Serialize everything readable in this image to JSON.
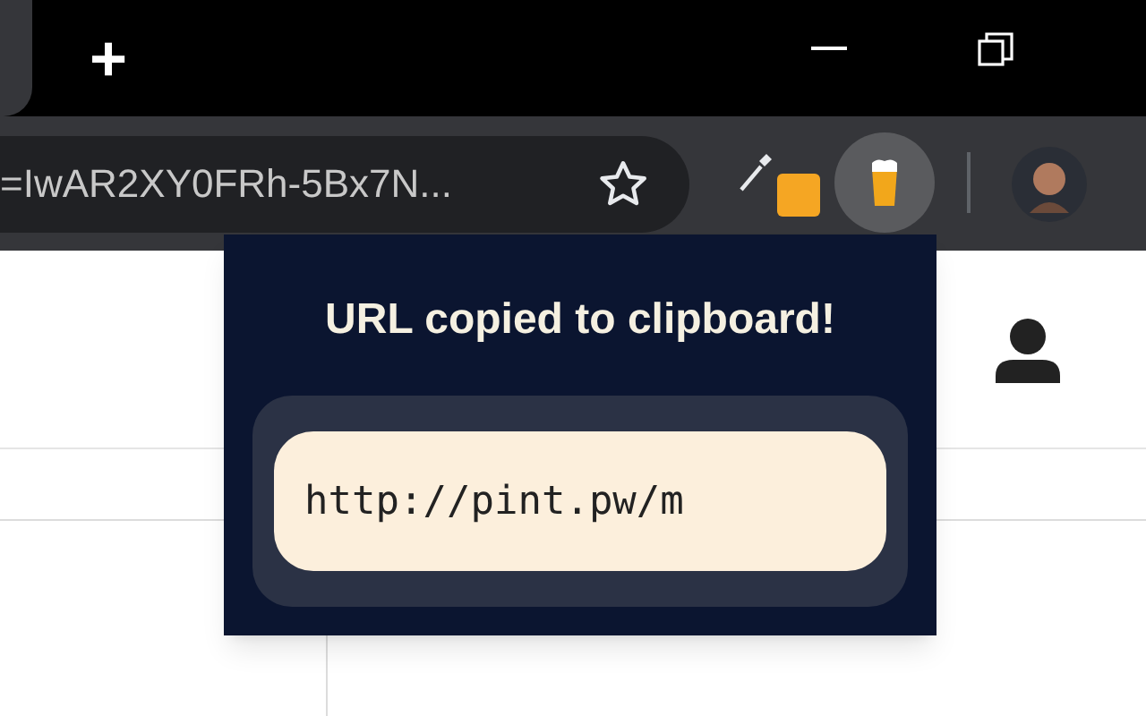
{
  "tab_strip": {
    "new_tab": "+"
  },
  "toolbar": {
    "address": "=IwAR2XY0FRh-5Bx7N...",
    "extension_badge": true
  },
  "popup": {
    "title": "URL copied to clipboard!",
    "url": "http://pint.pw/m"
  }
}
